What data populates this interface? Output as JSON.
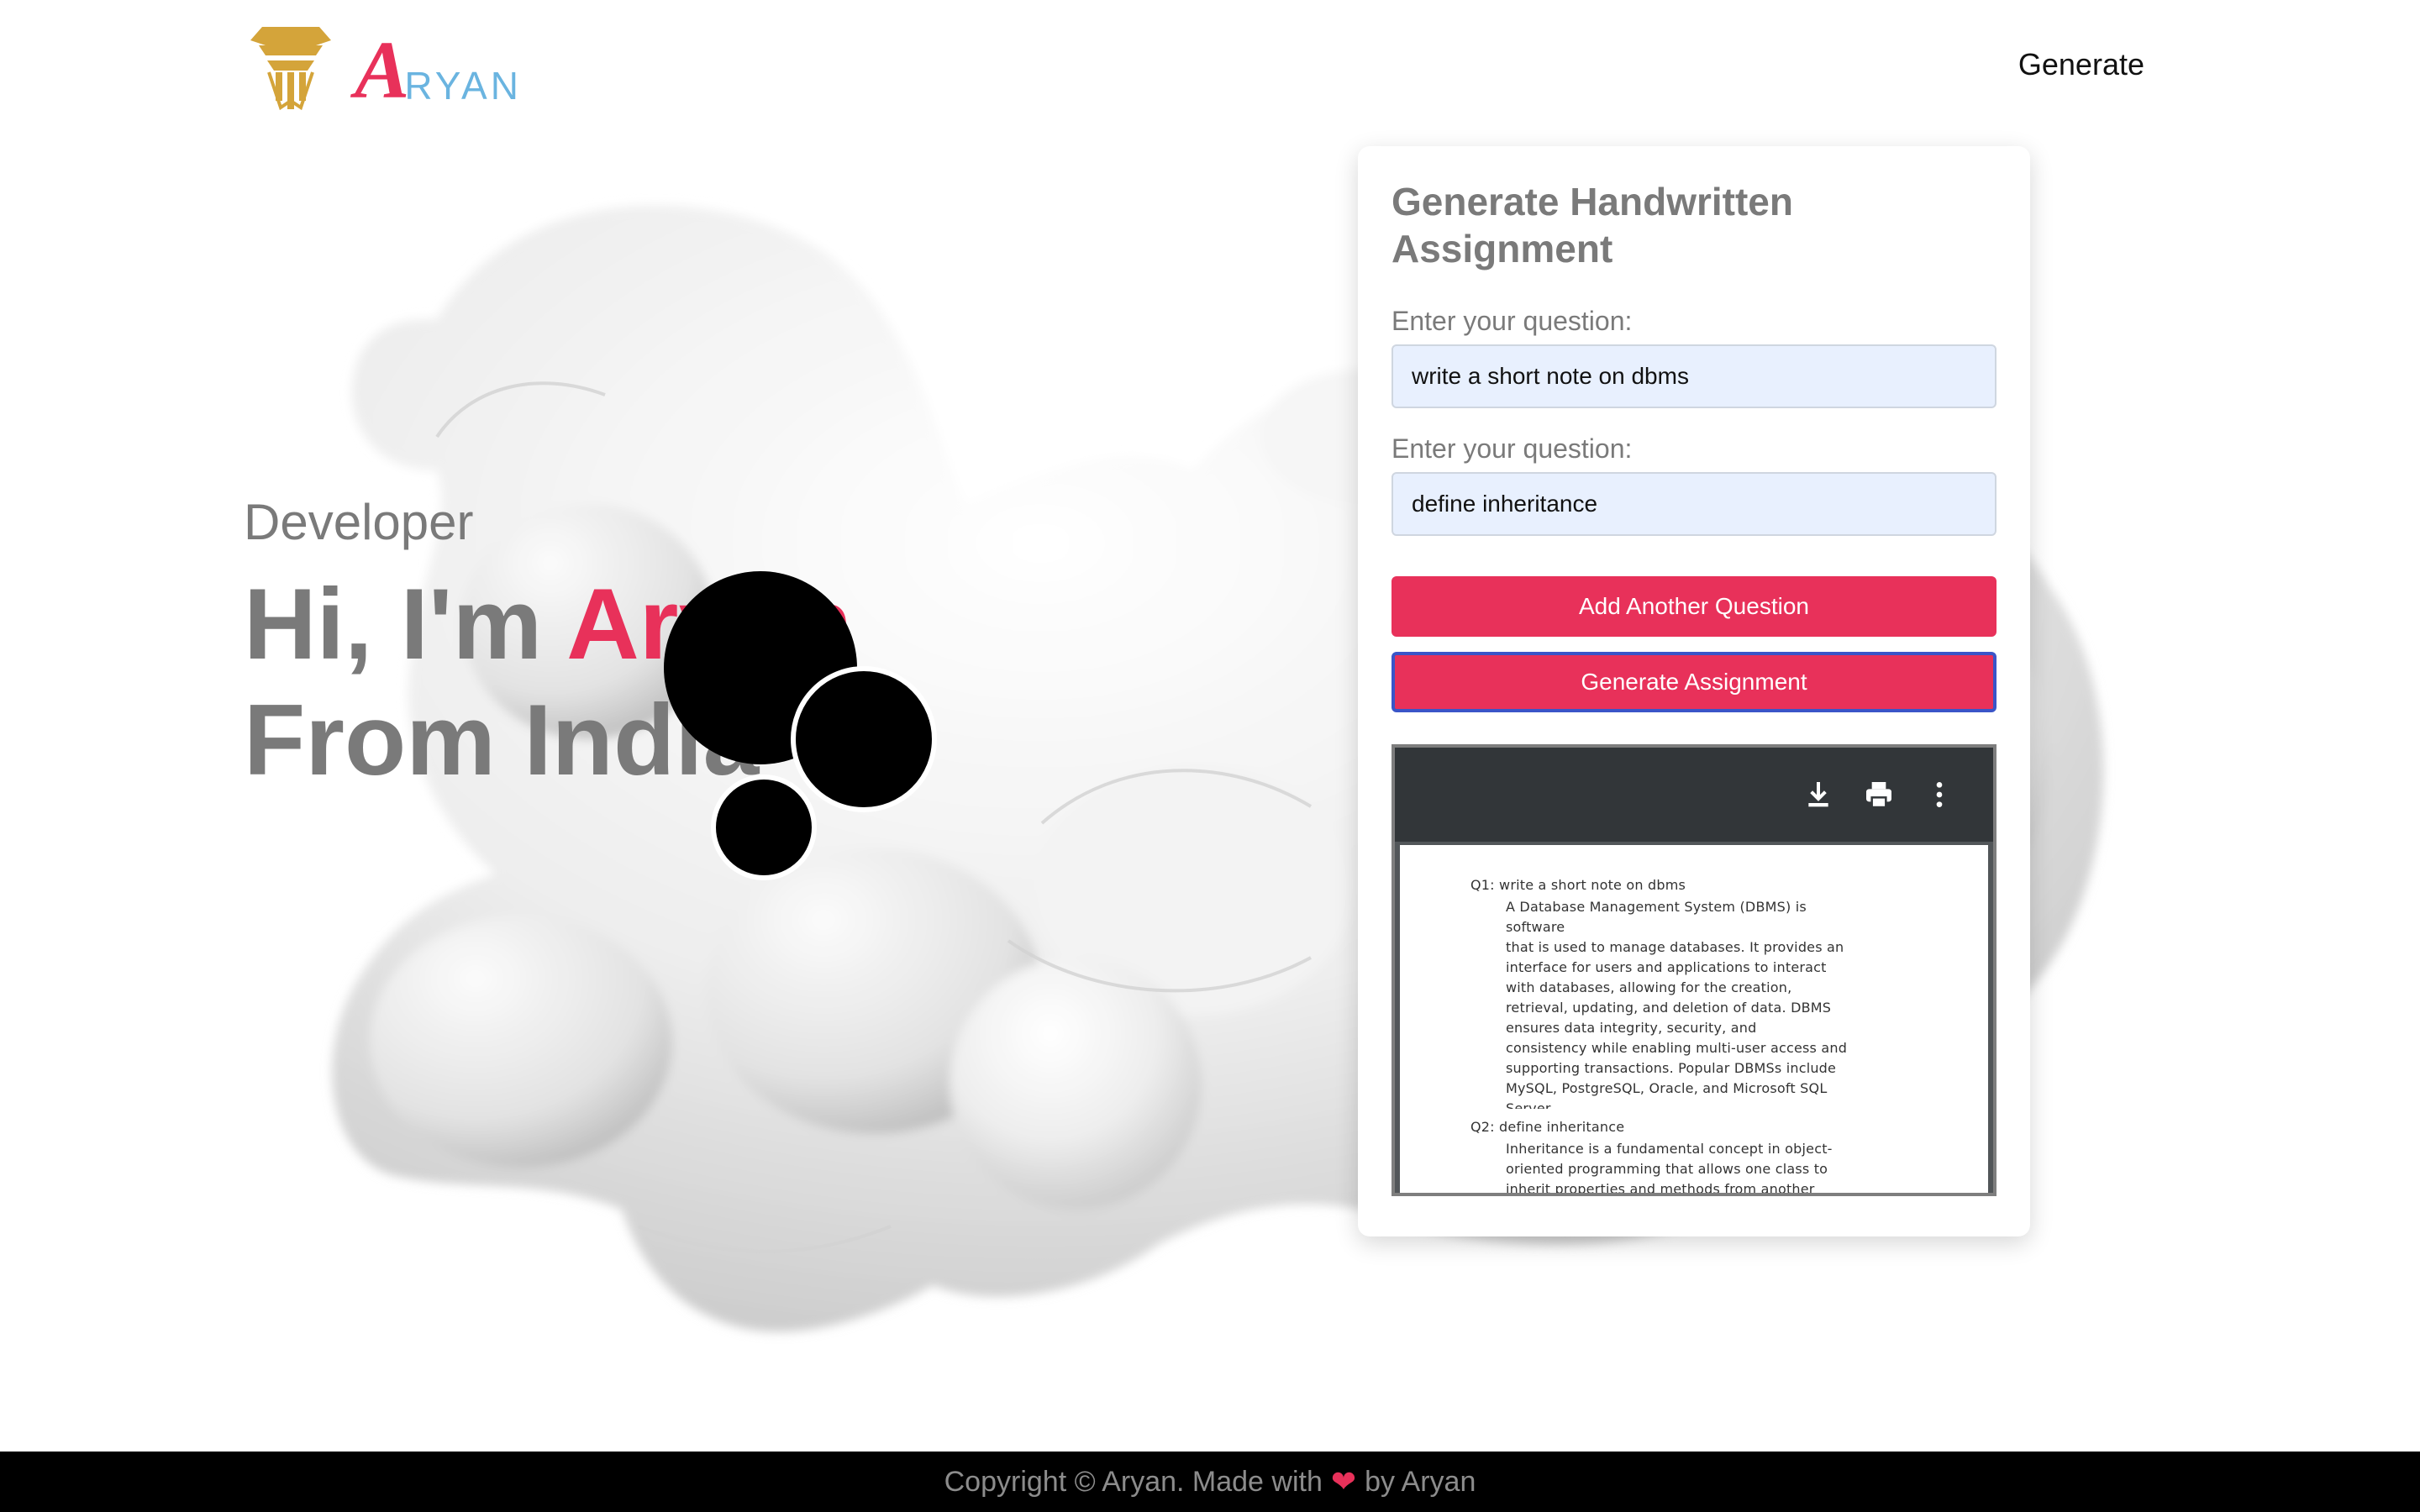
{
  "brand": {
    "logo_initial": "A",
    "logo_rest": "RYAN",
    "emblem_icon": "pillar-shield-icon",
    "colors": {
      "gold": "#d4a43a",
      "pink": "#e8315a",
      "blue": "#6ab4e0"
    }
  },
  "nav": {
    "generate_label": "Generate"
  },
  "hero": {
    "subtitle": "Developer",
    "line1_prefix": "Hi, I'm ",
    "line1_name": "Aryan",
    "line2": "From India"
  },
  "form": {
    "title": "Generate Handwritten Assignment",
    "questions": [
      {
        "label": "Enter your question:",
        "value": "write a short note on dbms"
      },
      {
        "label": "Enter your question:",
        "value": "define inheritance"
      }
    ],
    "add_button_label": "Add Another Question",
    "generate_button_label": "Generate Assignment"
  },
  "viewer": {
    "toolbar_icons": [
      "download-icon",
      "print-icon",
      "more-vert-icon"
    ],
    "answers": [
      {
        "question": "Q1: write a short note on dbms",
        "lines": [
          "A Database Management System (DBMS) is software",
          "that is used to manage databases. It provides an",
          "interface for users and applications to interact",
          "with databases, allowing for the creation,",
          "retrieval, updating, and deletion of data. DBMS",
          "ensures data integrity, security, and",
          "consistency while enabling multi-user access and",
          "supporting transactions. Popular DBMSs include",
          "MySQL, PostgreSQL, Oracle, and Microsoft SQL",
          "Server."
        ]
      },
      {
        "question": "Q2: define inheritance",
        "lines": [
          "Inheritance is a fundamental concept in object-",
          "oriented programming that allows one class to",
          "inherit properties and methods from another"
        ]
      }
    ]
  },
  "footer": {
    "text_before": "Copyright © Aryan. Made with",
    "heart_icon": "heart-icon",
    "text_after": "by Aryan"
  }
}
